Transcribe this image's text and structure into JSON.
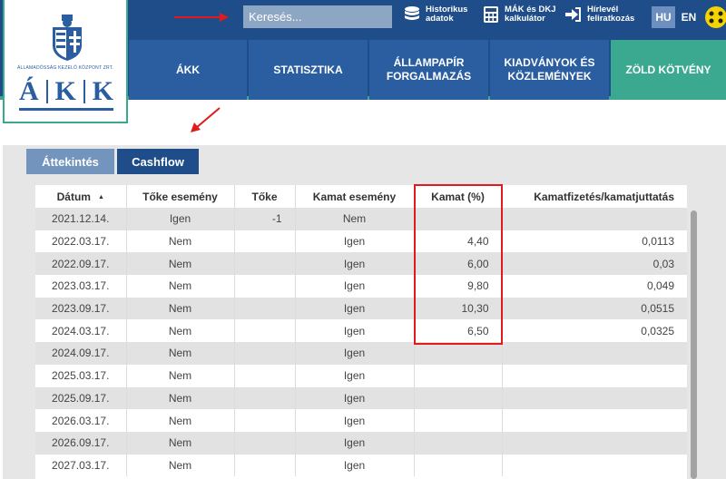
{
  "header": {
    "search_placeholder": "Keresés...",
    "links": [
      {
        "icon": "database-icon",
        "line1": "Historikus",
        "line2": "adatok"
      },
      {
        "icon": "calculator-icon",
        "line1": "MÁK és DKJ",
        "line2": "kalkulátor"
      },
      {
        "icon": "sign-in-icon",
        "line1": "Hírlevél",
        "line2": "feliratkozás"
      }
    ],
    "lang_active": "HU",
    "lang_other": "EN"
  },
  "logo": {
    "org_text": "ÁLLAMADÓSSÁG KEZELŐ KÖZPONT ZRT.",
    "letters": [
      "Á",
      "K",
      "K"
    ]
  },
  "nav": [
    {
      "line1": "ÁKK",
      "line2": ""
    },
    {
      "line1": "STATISZTIKA",
      "line2": ""
    },
    {
      "line1": "ÁLLAMPAPÍR",
      "line2": "FORGALMAZÁS"
    },
    {
      "line1": "KIADVÁNYOK ÉS",
      "line2": "KÖZLEMÉNYEK"
    },
    {
      "line1": "ZÖLD KÖTVÉNY",
      "line2": ""
    }
  ],
  "tabs": [
    {
      "label": "Áttekintés",
      "active": false
    },
    {
      "label": "Cashflow",
      "active": true
    }
  ],
  "table": {
    "headers": [
      "Dátum",
      "Tőke esemény",
      "Tőke",
      "Kamat esemény",
      "Kamat (%)",
      "Kamatfizetés/kamatjuttatás"
    ],
    "rows": [
      [
        "2021.12.14.",
        "Igen",
        "-1",
        "Nem",
        "",
        ""
      ],
      [
        "2022.03.17.",
        "Nem",
        "",
        "Igen",
        "4,40",
        "0,0113"
      ],
      [
        "2022.09.17.",
        "Nem",
        "",
        "Igen",
        "6,00",
        "0,03"
      ],
      [
        "2023.03.17.",
        "Nem",
        "",
        "Igen",
        "9,80",
        "0,049"
      ],
      [
        "2023.09.17.",
        "Nem",
        "",
        "Igen",
        "10,30",
        "0,0515"
      ],
      [
        "2024.03.17.",
        "Nem",
        "",
        "Igen",
        "6,50",
        "0,0325"
      ],
      [
        "2024.09.17.",
        "Nem",
        "",
        "Igen",
        "",
        ""
      ],
      [
        "2025.03.17.",
        "Nem",
        "",
        "Igen",
        "",
        ""
      ],
      [
        "2025.09.17.",
        "Nem",
        "",
        "Igen",
        "",
        ""
      ],
      [
        "2026.03.17.",
        "Nem",
        "",
        "Igen",
        "",
        ""
      ],
      [
        "2026.09.17.",
        "Nem",
        "",
        "Igen",
        "",
        ""
      ],
      [
        "2027.03.17.",
        "Nem",
        "",
        "Igen",
        "",
        ""
      ]
    ]
  },
  "colors": {
    "header_blue": "#1e4d89",
    "nav_blue": "#2a5ea0",
    "green": "#3aa98f",
    "annotation_red": "#e01b1b"
  }
}
